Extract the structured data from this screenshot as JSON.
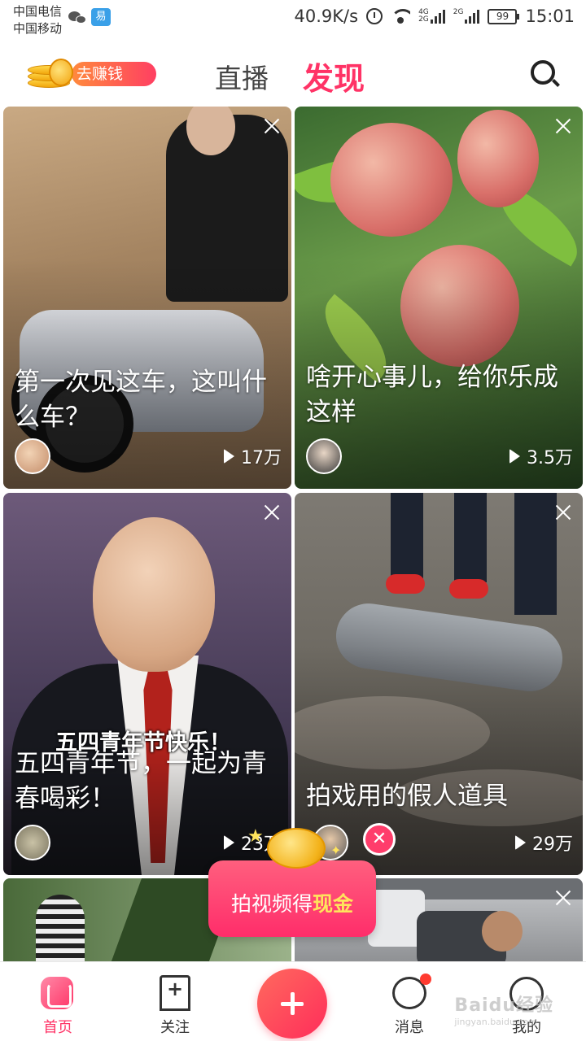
{
  "status_bar": {
    "carrier_1": "中国电信",
    "carrier_2": "中国移动",
    "app_badge": "易",
    "network_speed": "40.9K/s",
    "net_label_1": "4G",
    "net_label_2": "2G",
    "net_label_3": "2G",
    "battery": "99",
    "time": "15:01"
  },
  "header": {
    "earn_label": "去赚钱",
    "tab_live": "直播",
    "tab_discover": "发现",
    "active_tab": "发现"
  },
  "feed": [
    {
      "title": "第一次见这车，这叫什么车？",
      "plays": "17万"
    },
    {
      "title": "啥开心事儿，给你乐成这样",
      "plays": "3.5万"
    },
    {
      "title": "五四青年节，一起为青春喝彩！",
      "plays": "23万",
      "overlay_text": "五四青年节快乐！"
    },
    {
      "title": "拍戏用的假人道具",
      "plays": "29万"
    }
  ],
  "promo": {
    "text_prefix": "拍视频得",
    "text_highlight": "现金"
  },
  "bottom_nav": {
    "home": "首页",
    "follow": "关注",
    "messages": "消息",
    "me": "我的",
    "active": "首页"
  },
  "watermark": {
    "main": "Baidu经验",
    "sub": "jingyan.baidu.com"
  },
  "colors": {
    "accent": "#ff3366",
    "promo_highlight": "#ffe45c"
  }
}
